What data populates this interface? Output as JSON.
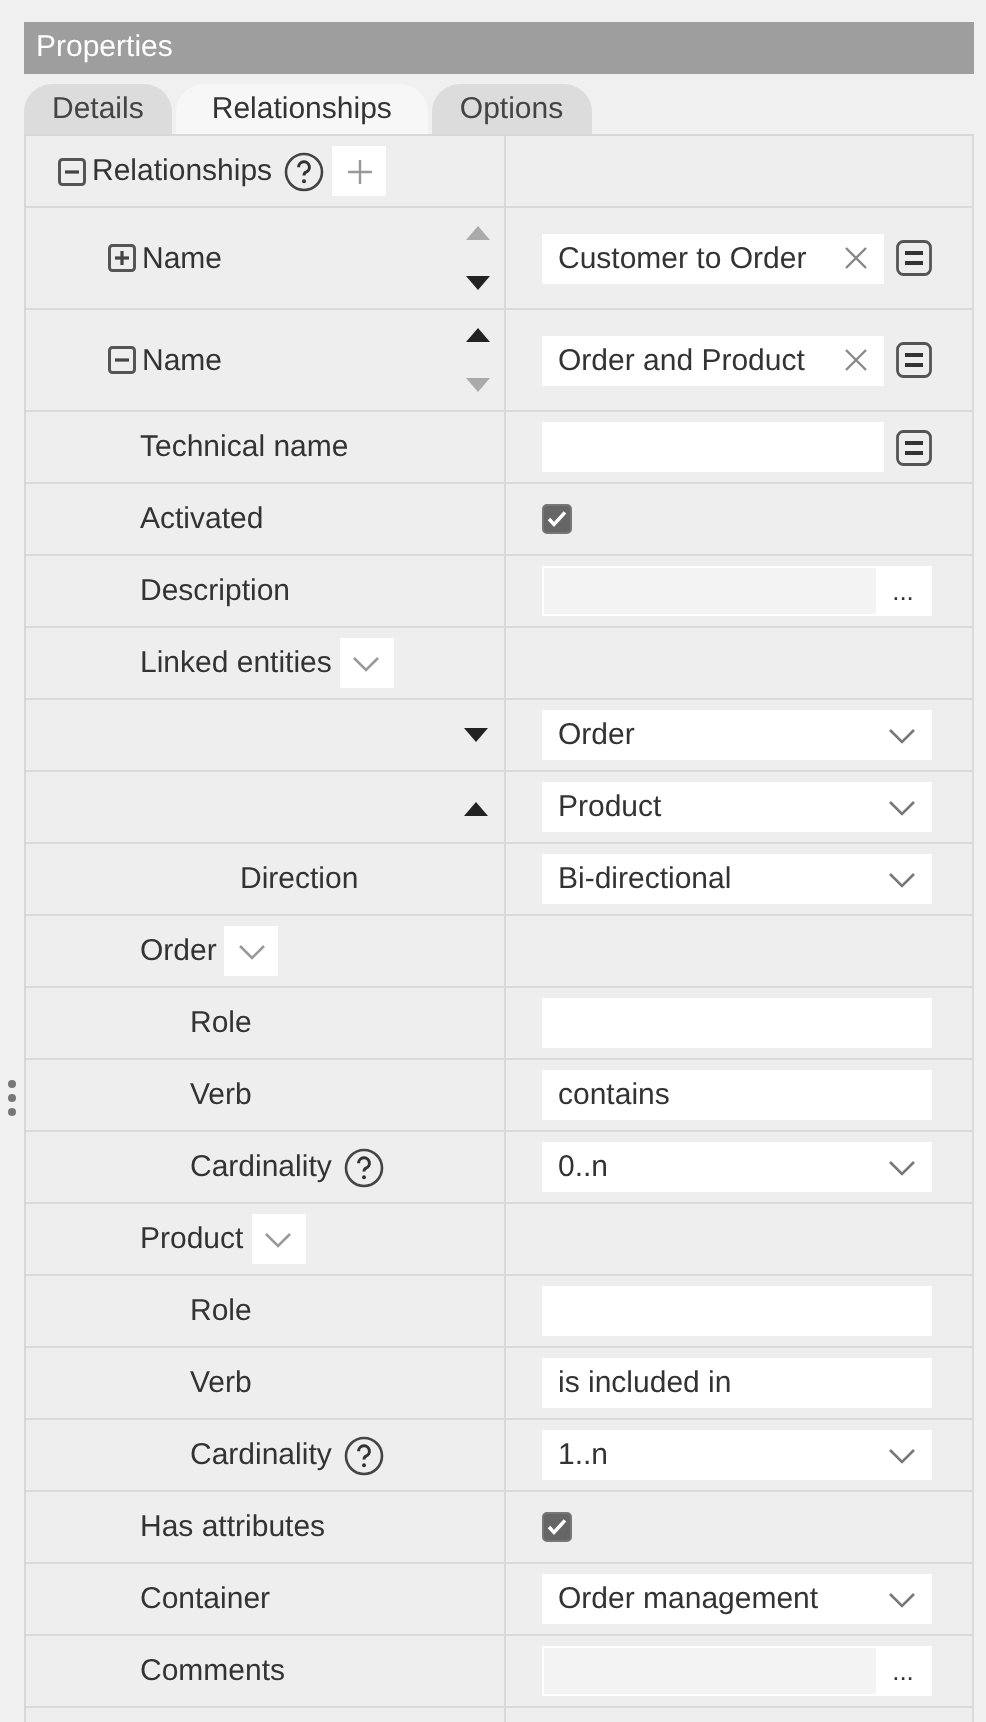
{
  "panel": {
    "title": "Properties"
  },
  "tabs": [
    {
      "label": "Details",
      "selected": false
    },
    {
      "label": "Relationships",
      "selected": true
    },
    {
      "label": "Options",
      "selected": false
    }
  ],
  "tree": [
    {
      "kind": "toggle",
      "label": "Relationships",
      "expanded": true,
      "help": true,
      "add": true,
      "children": [
        {
          "kind": "toggle",
          "label": "Name",
          "expanded": false,
          "sort": {
            "up_disabled": true,
            "down_disabled": false
          },
          "control": {
            "kind": "text",
            "value": "Customer to Order",
            "clearable": true,
            "menu": true
          }
        },
        {
          "kind": "toggle",
          "label": "Name",
          "expanded": true,
          "sort": {
            "up_disabled": false,
            "down_disabled": true
          },
          "control": {
            "kind": "text",
            "value": "Order and Product",
            "clearable": true,
            "menu": true
          },
          "children": [
            {
              "kind": "plain",
              "label": "Technical name",
              "control": {
                "kind": "text",
                "clearable": false,
                "menu": true
              }
            },
            {
              "kind": "plain",
              "label": "Activated",
              "control": {
                "kind": "checkbox",
                "checked": true
              }
            },
            {
              "kind": "plain",
              "label": "Description",
              "control": {
                "kind": "ellipsis",
                "button": "..."
              }
            },
            {
              "kind": "menu",
              "label": "Linked entities",
              "children": [
                {
                  "kind": "branch",
                  "expanded": false,
                  "control": {
                    "kind": "select",
                    "value": "Order"
                  }
                },
                {
                  "kind": "branch",
                  "expanded": true,
                  "control": {
                    "kind": "select",
                    "value": "Product"
                  },
                  "children": [
                    {
                      "kind": "plain",
                      "label": "Direction",
                      "control": {
                        "kind": "select",
                        "value": "Bi-directional"
                      }
                    }
                  ]
                }
              ]
            },
            {
              "kind": "menu",
              "label": "Order",
              "children": [
                {
                  "kind": "plain",
                  "label": "Role",
                  "control": {
                    "kind": "text",
                    "clearable": false,
                    "menu": false
                  }
                },
                {
                  "kind": "plain",
                  "label": "Verb",
                  "control": {
                    "kind": "text",
                    "value": "contains",
                    "clearable": false,
                    "menu": false
                  }
                },
                {
                  "kind": "plain",
                  "label": "Cardinality",
                  "help": true,
                  "control": {
                    "kind": "select",
                    "value": "0..n"
                  }
                }
              ]
            },
            {
              "kind": "menu",
              "label": "Product",
              "children": [
                {
                  "kind": "plain",
                  "label": "Role",
                  "control": {
                    "kind": "text",
                    "clearable": false,
                    "menu": false
                  }
                },
                {
                  "kind": "plain",
                  "label": "Verb",
                  "control": {
                    "kind": "text",
                    "value": "is included in",
                    "clearable": false,
                    "menu": false
                  }
                },
                {
                  "kind": "plain",
                  "label": "Cardinality",
                  "help": true,
                  "control": {
                    "kind": "select",
                    "value": "1..n"
                  }
                }
              ]
            },
            {
              "kind": "plain",
              "label": "Has attributes",
              "control": {
                "kind": "checkbox",
                "checked": true
              }
            },
            {
              "kind": "plain",
              "label": "Container",
              "control": {
                "kind": "select",
                "value": "Order management"
              }
            },
            {
              "kind": "plain",
              "label": "Comments",
              "control": {
                "kind": "ellipsis",
                "button": "..."
              }
            }
          ]
        }
      ]
    }
  ]
}
